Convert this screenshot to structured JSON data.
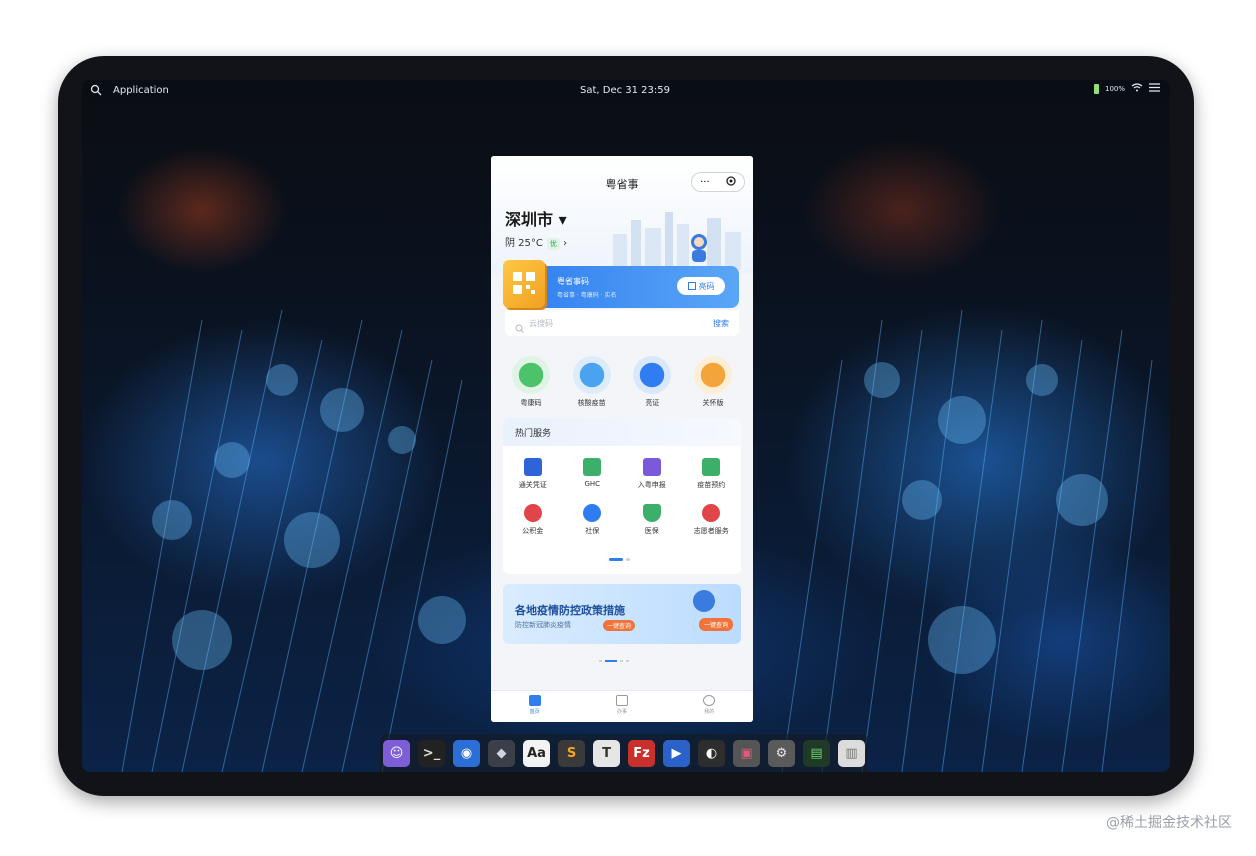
{
  "topbar": {
    "app_label": "Application",
    "datetime": "Sat, Dec 31   23:59",
    "battery": "100%"
  },
  "miniapp": {
    "title": "粤省事",
    "capsule_more": "···",
    "city": "深圳市 ▾",
    "weather": "阴 25°C",
    "aqi": "优",
    "banner": {
      "title": "粤省事码",
      "subtitle": "粤省事 · 粤康码 · 实名",
      "button": "亮码"
    },
    "search": {
      "placeholder": "云搜码",
      "button": "搜索"
    },
    "quick_services": [
      {
        "label": "粤康码",
        "color": "#4cc36a"
      },
      {
        "label": "核酸疫苗",
        "color": "#4aa3f0"
      },
      {
        "label": "亮证",
        "color": "#2f7df0"
      },
      {
        "label": "关怀版",
        "color": "#f3a43a"
      }
    ],
    "hot": {
      "title": "热门服务",
      "items": [
        {
          "label": "通关凭证",
          "color": "#2f63d8"
        },
        {
          "label": "GHC",
          "color": "#3cb06a"
        },
        {
          "label": "入粤申报",
          "color": "#7a5ad8"
        },
        {
          "label": "疫苗预约",
          "color": "#3cb06a"
        },
        {
          "label": "公积金",
          "color": "#e0454a"
        },
        {
          "label": "社保",
          "color": "#2f7df0"
        },
        {
          "label": "医保",
          "color": "#3cb06a"
        },
        {
          "label": "志愿者服务",
          "color": "#e0454a"
        }
      ]
    },
    "promo": {
      "title": "各地疫情防控政策措施",
      "subtitle": "防控新冠肺炎疫情",
      "button": "一键查询",
      "button2": "一键查询"
    },
    "tabs": [
      {
        "label": "首页"
      },
      {
        "label": "办事"
      },
      {
        "label": "我的"
      }
    ]
  },
  "dock": {
    "apps": [
      {
        "icon": "finder-icon",
        "glyph": "☺",
        "bg": "#7e5ed6",
        "fg": "#ffffff"
      },
      {
        "icon": "terminal-icon",
        "glyph": ">_",
        "bg": "#222222",
        "fg": "#dddddd"
      },
      {
        "icon": "chrome-icon",
        "glyph": "◉",
        "bg": "#2b6fd6",
        "fg": "#ffffff"
      },
      {
        "icon": "gem-icon",
        "glyph": "◆",
        "bg": "#3a3f48",
        "fg": "#cfd6df"
      },
      {
        "icon": "font-viewer-icon",
        "glyph": "Aa",
        "bg": "#f3f3f3",
        "fg": "#222222"
      },
      {
        "icon": "sublime-icon",
        "glyph": "S",
        "bg": "#3a3a3a",
        "fg": "#f5a623"
      },
      {
        "icon": "typora-icon",
        "glyph": "T",
        "bg": "#e6e6e6",
        "fg": "#333333"
      },
      {
        "icon": "filezilla-icon",
        "glyph": "Fz",
        "bg": "#c9302c",
        "fg": "#ffffff"
      },
      {
        "icon": "video-icon",
        "glyph": "▶",
        "bg": "#2a62c9",
        "fg": "#ffffff"
      },
      {
        "icon": "github-icon",
        "glyph": "◐",
        "bg": "#2d2d2d",
        "fg": "#ffffff"
      },
      {
        "icon": "app-icon",
        "glyph": "▣",
        "bg": "#555555",
        "fg": "#e05a7a"
      },
      {
        "icon": "settings-icon",
        "glyph": "⚙",
        "bg": "#5a5a5a",
        "fg": "#e6e6e6"
      },
      {
        "icon": "monitor-icon",
        "glyph": "▤",
        "bg": "#1f3a26",
        "fg": "#6fd36f"
      },
      {
        "icon": "trash-icon",
        "glyph": "▥",
        "bg": "#dcdcdc",
        "fg": "#777777"
      }
    ]
  },
  "watermark": "@稀土掘金技术社区"
}
